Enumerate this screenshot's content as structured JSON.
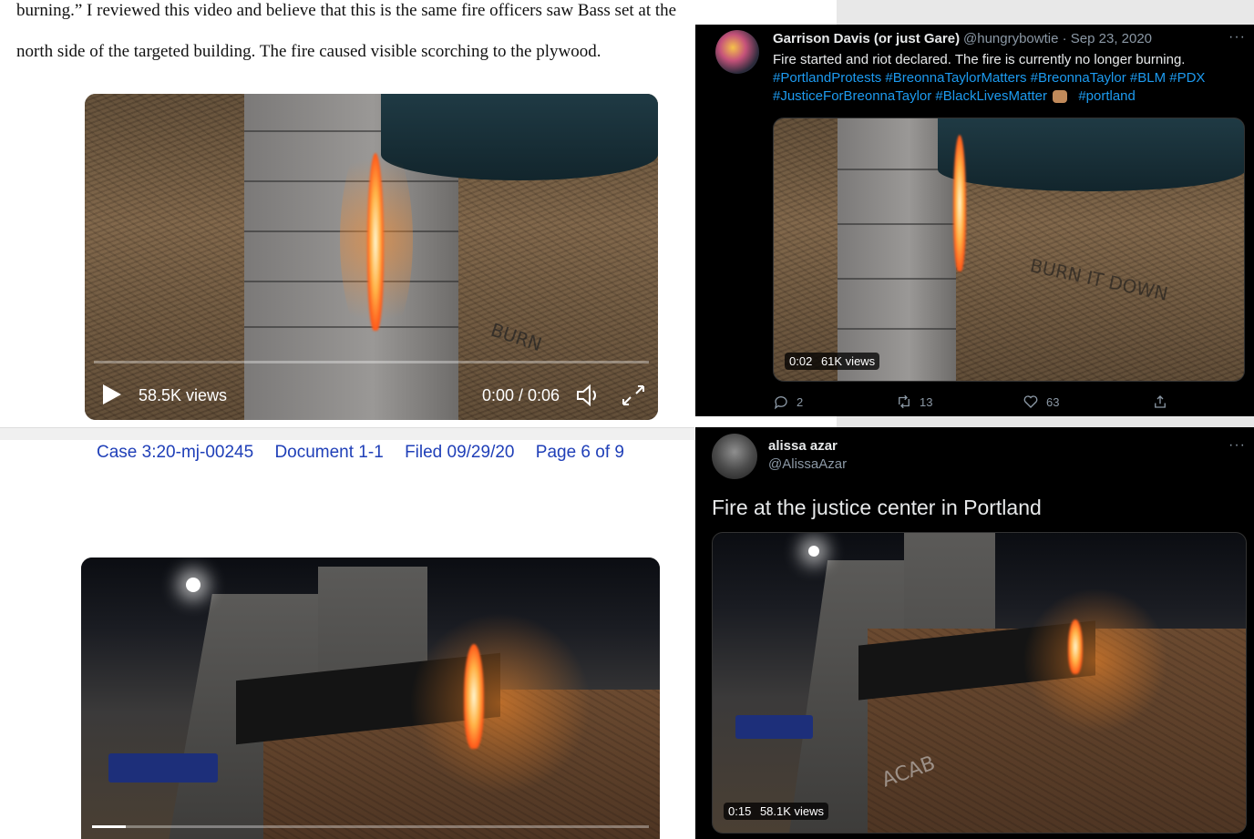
{
  "document": {
    "line1": "burning.” I reviewed this video and believe that this is the same fire officers saw Bass set at the",
    "line2": "north side of the targeted building. The fire caused visible scorching to the plywood.",
    "case_header": {
      "case": "Case 3:20-mj-00245",
      "document": "Document 1-1",
      "filed": "Filed 09/29/20",
      "page": "Page 6 of 9"
    }
  },
  "video_top_left": {
    "views": "58.5K views",
    "time": "0:00 / 0:06",
    "graffiti": "BURN"
  },
  "video_bottom_left": {
    "progress": 0.06
  },
  "tweet_top": {
    "name": "Garrison Davis (or just Gare)",
    "handle_date": "@hungrybowtie · Sep 23, 2020",
    "text": "Fire started and riot declared. The fire is currently no longer burning.",
    "hashtags_line1": "#PortlandProtests #BreonnaTaylorMatters #BreonnaTaylor #BLM #PDX",
    "hashtags_line2": "#JusticeForBreonnaTaylor #BlackLivesMatter",
    "hashtags_line2b": "#portland",
    "video_time": "0:02",
    "video_views": "61K views",
    "replies": "2",
    "retweets": "13",
    "likes": "63",
    "graffiti": "BURN IT DOWN"
  },
  "tweet_bottom": {
    "name": "alissa azar",
    "handle": "@AlissaAzar",
    "text": "Fire at the justice center in Portland",
    "video_time": "0:15",
    "video_views": "58.1K views",
    "graffiti": "ACAB"
  },
  "icons": {
    "more": "more-horizontal-icon",
    "reply": "reply-icon",
    "retweet": "retweet-icon",
    "like": "heart-icon",
    "share": "share-icon",
    "play": "play-icon",
    "volume": "volume-icon",
    "expand": "expand-icon"
  },
  "colors": {
    "tweet_bg": "#000000",
    "link_blue": "#1d9bf0",
    "case_blue": "#1f3fb8"
  }
}
